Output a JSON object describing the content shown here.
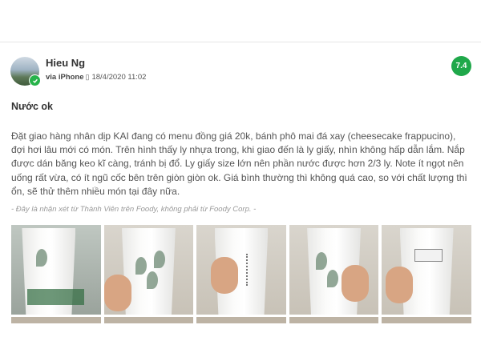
{
  "review": {
    "username": "Hieu Ng",
    "via": "via iPhone",
    "device_icon": "phone-icon",
    "datetime": "18/4/2020 11:02",
    "score": "7.4",
    "title": "Nước ok",
    "body": "Đặt giao hàng nhân dịp KAI đang có menu đồng giá 20k, bánh phô mai đá xay (cheesecake frappucino), đợi hơi lâu mới có món. Trên hình thấy ly nhựa trong, khi giao đến là ly giấy, nhìn không hấp dẫn lắm. Nắp được dán băng keo kĩ càng, tránh bị đổ. Ly giấy size lớn nên phần nước được hơn 2/3 ly. Note ít ngọt nên uống rất vừa, có ít ngũ cốc bên trên giòn giòn ok. Giá bình thường thì không quá cao, so với chất lượng thì ổn, sẽ thử thêm nhiều món tại đây nữa.",
    "note": "- Đây là nhận xét từ Thành Viên trên Foody, không phải từ Foody Corp. -"
  },
  "colors": {
    "score_bg": "#1fa84a",
    "verified": "#27b34a"
  },
  "photos": [
    {
      "name": "photo-1",
      "subject": "paper cup in plastic bag"
    },
    {
      "name": "photo-2",
      "subject": "paper cup with leaf print held in hand"
    },
    {
      "name": "photo-3",
      "subject": "paper cup side label held in hand"
    },
    {
      "name": "photo-4",
      "subject": "paper cup with leaf print held in hand"
    },
    {
      "name": "photo-5",
      "subject": "paper cup with label held in hand"
    }
  ]
}
